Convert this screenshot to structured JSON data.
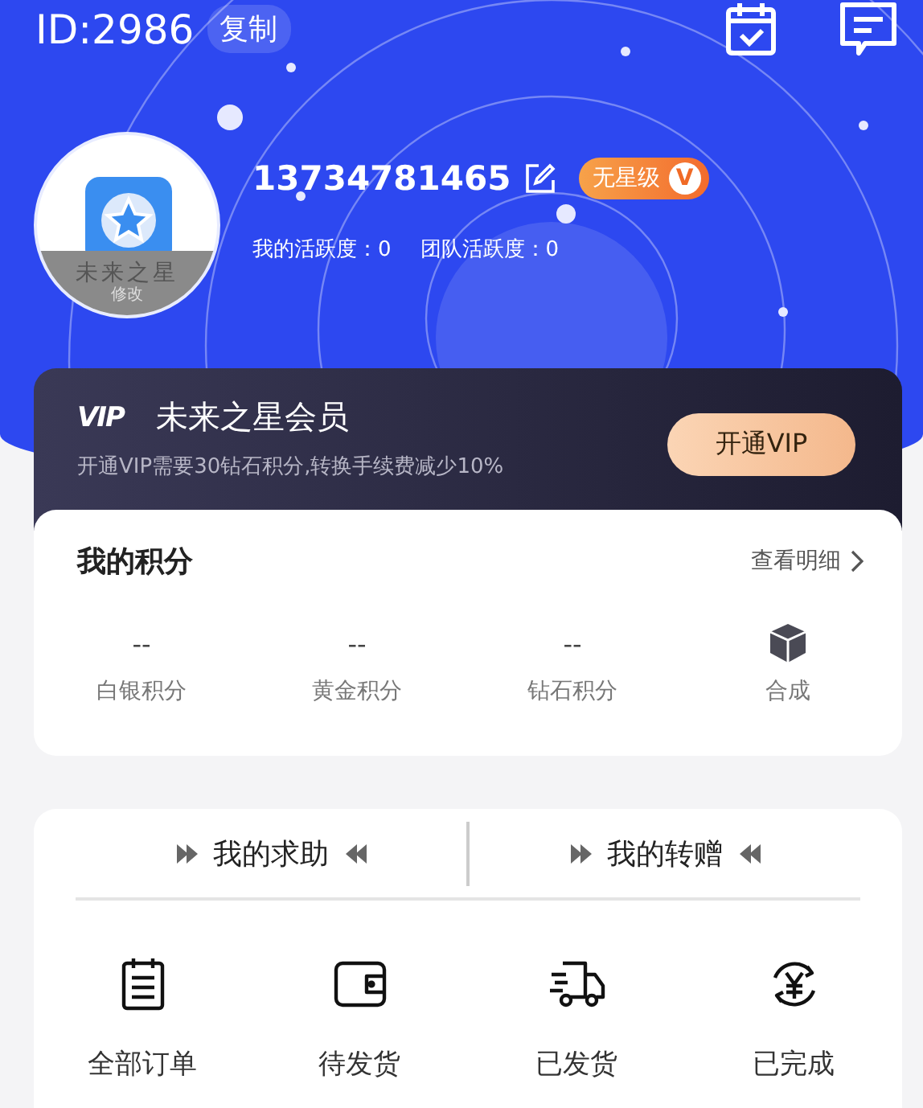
{
  "header": {
    "id_label": "ID:2986",
    "copy_button": "复制"
  },
  "profile": {
    "avatar_text": "未来之星",
    "avatar_edit": "修改",
    "phone": "13734781465",
    "level_badge": "无星级",
    "level_badge_mark": "V",
    "activity": [
      "我的活跃度：0",
      "团队活跃度：0"
    ]
  },
  "vip": {
    "logo": "VIP",
    "title": "未来之星会员",
    "description": "开通VIP需要30钻石积分,转换手续费减少10%",
    "button": "开通VIP"
  },
  "points": {
    "title": "我的积分",
    "link": "查看明细",
    "items": [
      {
        "kind": "value",
        "value": "--",
        "label": "白银积分"
      },
      {
        "kind": "value",
        "value": "--",
        "label": "黄金积分"
      },
      {
        "kind": "value",
        "value": "--",
        "label": "钻石积分"
      },
      {
        "kind": "icon",
        "label": "合成"
      }
    ]
  },
  "help_tabs": [
    {
      "label": "我的求助"
    },
    {
      "label": "我的转赠"
    }
  ],
  "orders": [
    {
      "kind": "all",
      "label": "全部订单"
    },
    {
      "kind": "pending",
      "label": "待发货"
    },
    {
      "kind": "shipped",
      "label": "已发货"
    },
    {
      "kind": "done",
      "label": "已完成"
    }
  ]
}
